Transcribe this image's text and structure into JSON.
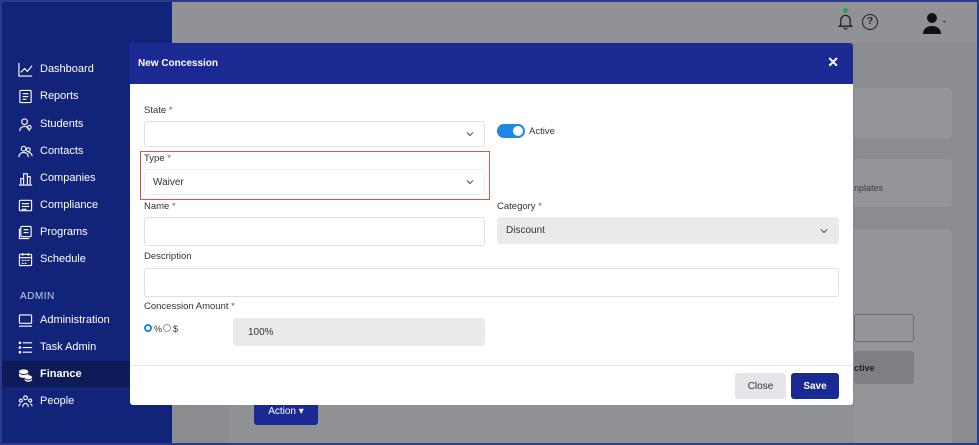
{
  "sidebar": {
    "items": [
      {
        "label": "Dashboard",
        "icon": "chart-line-icon"
      },
      {
        "label": "Reports",
        "icon": "report-icon"
      },
      {
        "label": "Students",
        "icon": "students-icon"
      },
      {
        "label": "Contacts",
        "icon": "contacts-icon"
      },
      {
        "label": "Companies",
        "icon": "companies-icon"
      },
      {
        "label": "Compliance",
        "icon": "compliance-icon"
      },
      {
        "label": "Programs",
        "icon": "programs-icon"
      },
      {
        "label": "Schedule",
        "icon": "calendar-icon"
      }
    ],
    "section_label": "ADMIN",
    "admin_items": [
      {
        "label": "Administration",
        "icon": "monitor-icon"
      },
      {
        "label": "Task Admin",
        "icon": "list-icon"
      },
      {
        "label": "Finance",
        "icon": "coins-icon",
        "active": true
      },
      {
        "label": "People",
        "icon": "people-icon"
      }
    ]
  },
  "background": {
    "templates_fragment": "nplates",
    "active_fragment": "ctive",
    "action_label": "Action ▾"
  },
  "modal": {
    "title": "New Concession",
    "close_symbol": "✕",
    "state": {
      "label": "State",
      "required": "*",
      "value": ""
    },
    "active_toggle": {
      "label": "Active",
      "on": true
    },
    "type": {
      "label": "Type",
      "required": "*",
      "value": "Waiver"
    },
    "name": {
      "label": "Name",
      "required": "*",
      "value": ""
    },
    "category": {
      "label": "Category",
      "required": "*",
      "value": "Discount"
    },
    "description": {
      "label": "Description",
      "value": ""
    },
    "amount": {
      "label": "Concession Amount",
      "required": "*",
      "percent_label": "%",
      "dollar_label": "$",
      "selected": "%",
      "value": "100%"
    },
    "close_button": "Close",
    "save_button": "Save"
  },
  "colors": {
    "sidebar": "#11247a",
    "primary": "#1b2a93",
    "toggle": "#1e88e5",
    "highlight": "#d9534f"
  }
}
